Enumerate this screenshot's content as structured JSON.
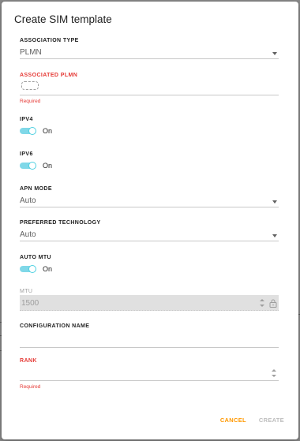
{
  "dialog": {
    "title": "Create SIM template"
  },
  "fields": {
    "association_type": {
      "label": "ASSOCIATION TYPE",
      "value": "PLMN"
    },
    "associated_plmn": {
      "label": "ASSOCIATED PLMN",
      "helper": "Required"
    },
    "ipv4": {
      "label": "IPV4",
      "state": "On"
    },
    "ipv6": {
      "label": "IPV6",
      "state": "On"
    },
    "apn_mode": {
      "label": "APN MODE",
      "value": "Auto"
    },
    "preferred_technology": {
      "label": "PREFERRED TECHNOLOGY",
      "value": "Auto"
    },
    "auto_mtu": {
      "label": "AUTO MTU",
      "state": "On"
    },
    "mtu": {
      "label": "MTU",
      "value": "1500"
    },
    "configuration_name": {
      "label": "CONFIGURATION NAME",
      "value": ""
    },
    "rank": {
      "label": "RANK",
      "helper": "Required"
    }
  },
  "actions": {
    "cancel": "CANCEL",
    "create": "CREATE"
  },
  "colors": {
    "accent": "#ff9800",
    "error": "#e53935",
    "toggle": "#4dd0e1"
  }
}
